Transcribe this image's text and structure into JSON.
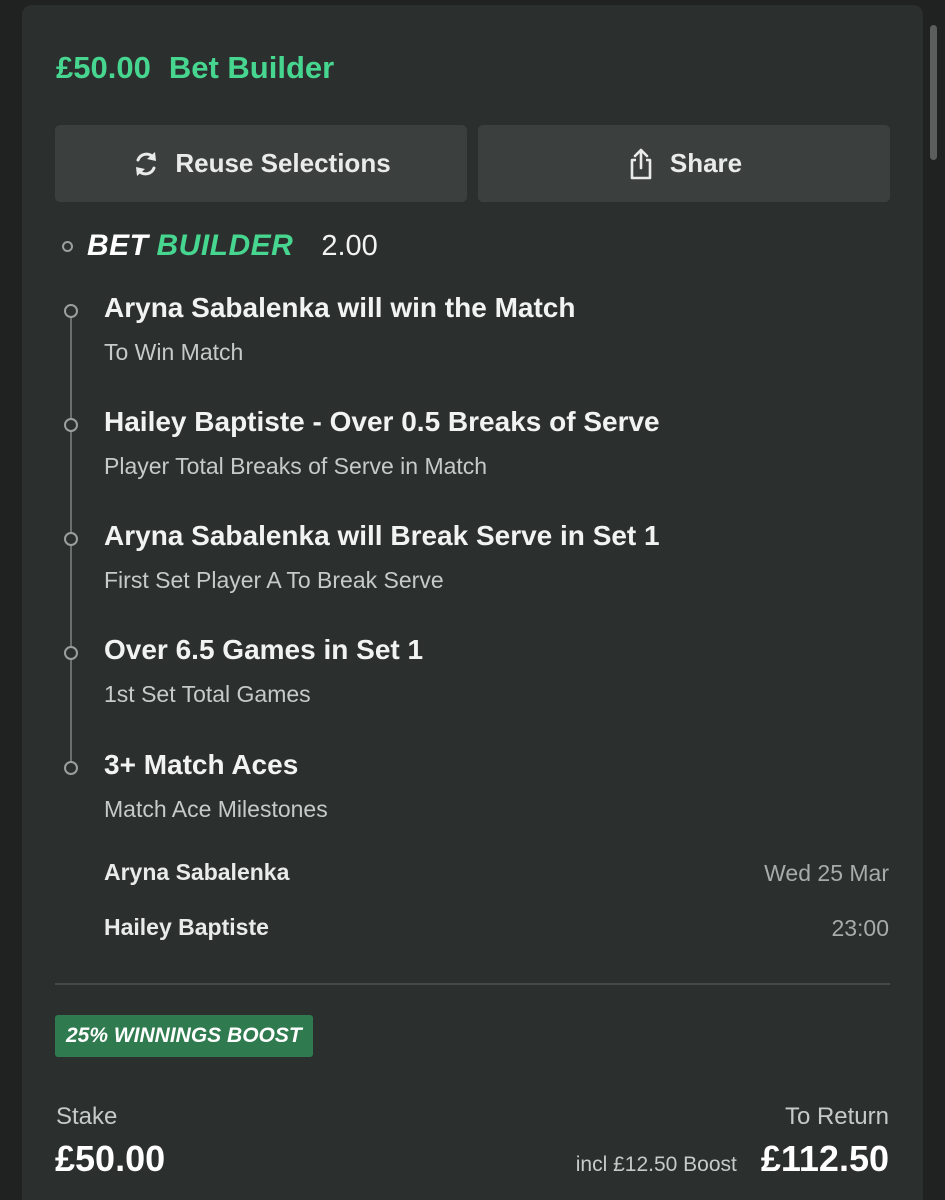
{
  "header": {
    "stake_amount": "£50.00",
    "bet_type": "Bet Builder"
  },
  "actions": {
    "reuse_label": "Reuse Selections",
    "share_label": "Share",
    "reuse_icon": "refresh-icon",
    "share_icon": "share-icon"
  },
  "bet_builder": {
    "logo_white": "BET",
    "logo_green": "BUILDER",
    "odds": "2.00"
  },
  "selections": [
    {
      "title": "Aryna Sabalenka will win the Match",
      "market": "To Win Match"
    },
    {
      "title": "Hailey Baptiste - Over 0.5 Breaks of Serve",
      "market": "Player Total Breaks of Serve in Match"
    },
    {
      "title": "Aryna Sabalenka will Break Serve in Set 1",
      "market": "First Set Player A To Break Serve"
    },
    {
      "title": "Over 6.5 Games in Set 1",
      "market": "1st Set Total Games"
    },
    {
      "title": "3+ Match Aces",
      "market": "Match Ace Milestones"
    }
  ],
  "match": {
    "player_a": "Aryna Sabalenka",
    "player_b": "Hailey Baptiste",
    "date": "Wed 25 Mar",
    "time": "23:00"
  },
  "boost": {
    "badge": "25% WINNINGS BOOST"
  },
  "summary": {
    "stake_label": "Stake",
    "stake_value": "£50.00",
    "return_label": "To Return",
    "boost_note": "incl £12.50 Boost",
    "return_value": "£112.50"
  },
  "colors": {
    "accent_green": "#46d68f",
    "card_bg": "#2b302e",
    "button_bg": "#3b403e",
    "badge_bg": "#2f7b4f"
  }
}
